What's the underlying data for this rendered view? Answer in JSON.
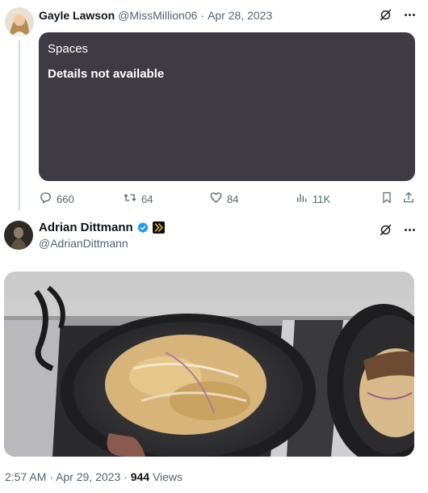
{
  "tweet1": {
    "name": "Gayle Lawson",
    "handle": "@MissMillion06",
    "separator": "·",
    "date": "Apr 28, 2023",
    "spaces": {
      "label": "Spaces",
      "details": "Details not available"
    },
    "actions": {
      "replies": "660",
      "reposts": "64",
      "likes": "84",
      "views": "11K"
    }
  },
  "tweet2": {
    "name": "Adrian Dittmann",
    "handle": "@AdrianDittmann",
    "time": "2:57 AM",
    "separator": "·",
    "date": "Apr 29, 2023",
    "separator2": "·",
    "views_count": "944",
    "views_label": "Views"
  },
  "colors": {
    "accent": "#1d9bf0",
    "muted": "#536471",
    "card": "#3e3b44"
  },
  "icons": [
    "grok-icon",
    "more-icon",
    "reply-icon",
    "repost-icon",
    "like-icon",
    "views-icon",
    "bookmark-icon",
    "share-icon",
    "verified-badge-icon",
    "affiliate-badge-icon"
  ]
}
